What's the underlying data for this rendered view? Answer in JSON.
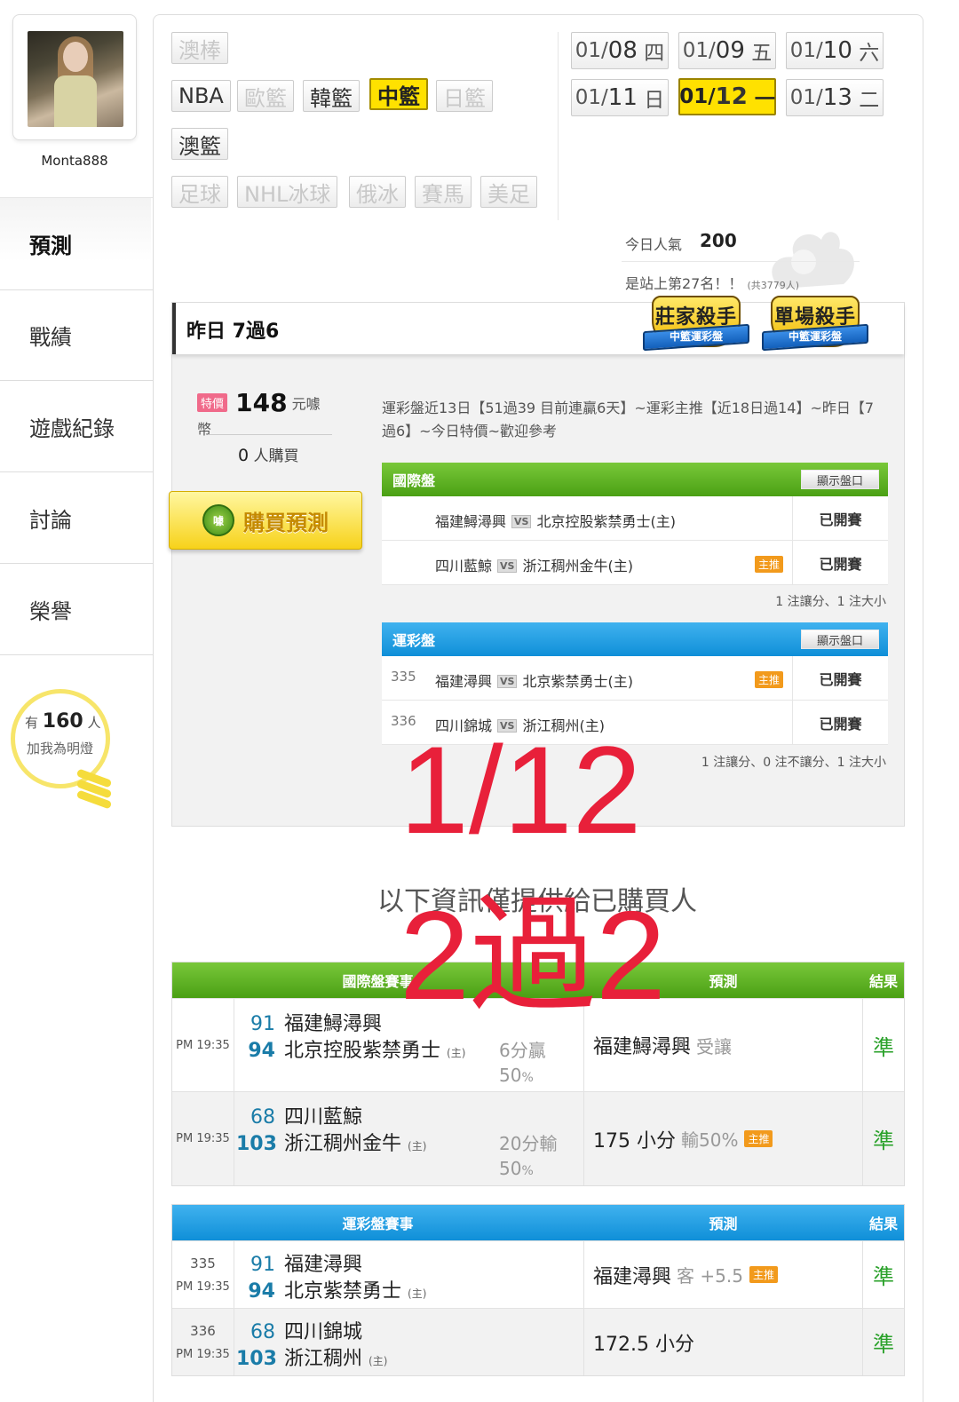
{
  "profile": {
    "username": "Monta888"
  },
  "nav": [
    {
      "label": "預測",
      "active": true
    },
    {
      "label": "戰績"
    },
    {
      "label": "遊戲紀錄"
    },
    {
      "label": "討論"
    },
    {
      "label": "榮譽"
    }
  ],
  "fans": {
    "prefix": "有",
    "count": "160",
    "suffix": "人",
    "caption": "加我為明燈"
  },
  "sports": {
    "row1": [
      {
        "label": "澳棒",
        "dim": true
      }
    ],
    "row2": [
      {
        "label": "NBA"
      },
      {
        "label": "歐籃",
        "dim": true
      },
      {
        "label": "韓籃"
      },
      {
        "label": "中籃",
        "active": true
      },
      {
        "label": "日籃",
        "dim": true
      }
    ],
    "row3": [
      {
        "label": "澳籃"
      }
    ],
    "row4": [
      {
        "label": "足球",
        "dim": true
      },
      {
        "label": "NHL冰球",
        "dim": true
      },
      {
        "label": "俄冰",
        "dim": true
      },
      {
        "label": "賽馬",
        "dim": true
      },
      {
        "label": "美足",
        "dim": true
      }
    ]
  },
  "dates": [
    {
      "md": "01/",
      "d": "08",
      "wd": "四"
    },
    {
      "md": "01/",
      "d": "09",
      "wd": "五"
    },
    {
      "md": "01/",
      "d": "10",
      "wd": "六"
    },
    {
      "md": "01/",
      "d": "11",
      "wd": "日"
    },
    {
      "md": "01/",
      "d": "12",
      "wd": "一",
      "active": true
    },
    {
      "md": "01/",
      "d": "13",
      "wd": "二"
    }
  ],
  "popularity": {
    "label": "今日人氣",
    "value": "200",
    "rank_text": "是站上第27名！！",
    "rank_total": "(共3779人)"
  },
  "panel": {
    "title": "昨日 7過6",
    "badge1": {
      "title": "莊家殺手",
      "sub": "中籃運彩盤"
    },
    "badge2": {
      "title": "單場殺手",
      "sub": "中籃運彩盤"
    },
    "price_tag": "特價",
    "price": "148",
    "price_unit": "元噱幣",
    "buyers_count": "0",
    "buyers_label": "人購買",
    "buy_icon": "噱",
    "buy_label": "購買預測",
    "description": "運彩盤近13日【51過39 目前連贏6天】~運彩主推【近18日過14】~昨日【7過6】~今日特價~歡迎參考",
    "intl": {
      "title": "國際盤",
      "show": "顯示盤口",
      "rows": [
        {
          "num": "",
          "away": "福建鱘潯興",
          "home": "北京控股紫禁勇士(主)",
          "tuiji": "",
          "status": "已開賽"
        },
        {
          "num": "",
          "away": "四川藍鯨",
          "home": "浙江稠州金牛(主)",
          "tuiji": "主推",
          "status": "已開賽"
        }
      ],
      "summary": "1 注讓分、1 注大小"
    },
    "lottery": {
      "title": "運彩盤",
      "show": "顯示盤口",
      "rows": [
        {
          "num": "335",
          "away": "福建潯興",
          "home": "北京紫禁勇士(主)",
          "tuiji": "主推",
          "status": "已開賽"
        },
        {
          "num": "336",
          "away": "四川錦城",
          "home": "浙江稠州(主)",
          "tuiji": "",
          "status": "已開賽"
        }
      ],
      "summary": "1 注讓分、0 注不讓分、1 注大小"
    },
    "vs": "VS"
  },
  "overlay": {
    "date": "1/12",
    "record": "2過2"
  },
  "purchased_note": "以下資訊僅提供給已購買人",
  "intl_table": {
    "headers": {
      "match": "國際盤賽事",
      "pred": "預測",
      "result": "結果"
    },
    "rows": [
      {
        "time": "PM 19:35",
        "n1": "91",
        "t1": "福建鱘潯興",
        "n2": "94",
        "t2": "北京控股紫禁勇士",
        "home": "(主)",
        "hc1": "6分贏",
        "hc2": "50",
        "pct": "%",
        "pick": "福建鱘潯興",
        "pick_note": "受讓",
        "tuiji": "",
        "result": "準"
      },
      {
        "time": "PM 19:35",
        "n1": "68",
        "t1": "四川藍鯨",
        "n2": "103",
        "t2": "浙江稠州金牛",
        "home": "(主)",
        "hc1": "20分輸",
        "hc2": "50",
        "pct": "%",
        "pick": "175 小分",
        "pick_note": "輸50%",
        "tuiji": "主推",
        "result": "準"
      }
    ]
  },
  "lottery_table": {
    "headers": {
      "match": "運彩盤賽事",
      "pred": "預測",
      "result": "結果"
    },
    "rows": [
      {
        "id": "335",
        "time": "PM 19:35",
        "n1": "91",
        "t1": "福建潯興",
        "n2": "94",
        "t2": "北京紫禁勇士",
        "home": "(主)",
        "pick": "福建潯興",
        "pick_note": "客 +5.5",
        "tuiji": "主推",
        "result": "準"
      },
      {
        "id": "336",
        "time": "PM 19:35",
        "n1": "68",
        "t1": "四川錦城",
        "n2": "103",
        "t2": "浙江稠州",
        "home": "(主)",
        "pick": "172.5 小分",
        "pick_note": "",
        "tuiji": "",
        "result": "準"
      }
    ]
  },
  "colors": {
    "accent_yellow": "#ffe100",
    "green_header": "#4aa014",
    "blue_header": "#0f8fd8",
    "overlay_red": "#e8203a",
    "correct_green": "#2aa12a"
  }
}
